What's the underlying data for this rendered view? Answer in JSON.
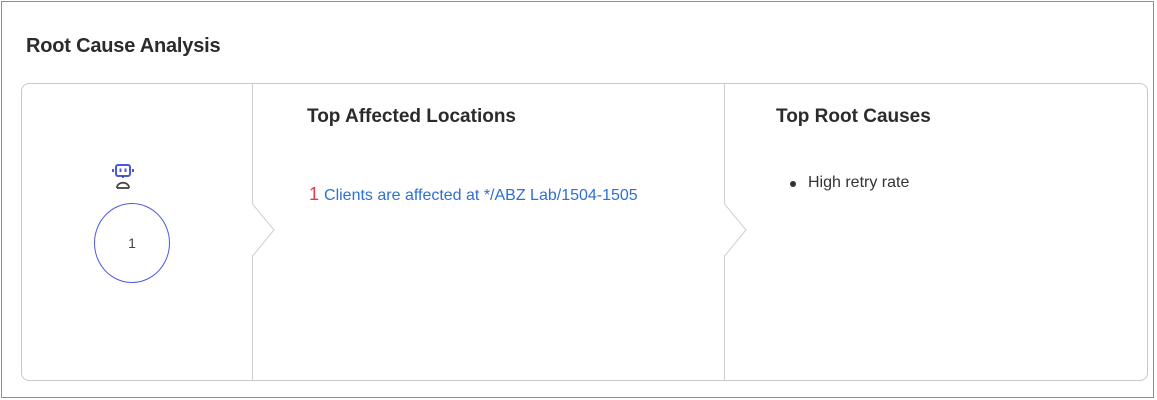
{
  "panel": {
    "title": "Root Cause Analysis"
  },
  "summary": {
    "icon": "robot-icon",
    "count": "1",
    "accent": "#4a57e0"
  },
  "locations": {
    "title": "Top Affected Locations",
    "count": "1",
    "text": "Clients are affected at */ABZ Lab/1504-1505",
    "count_color": "#e0394a",
    "link_color": "#2e6fd6"
  },
  "root_causes": {
    "title": "Top Root Causes",
    "items": [
      "High retry rate"
    ]
  }
}
